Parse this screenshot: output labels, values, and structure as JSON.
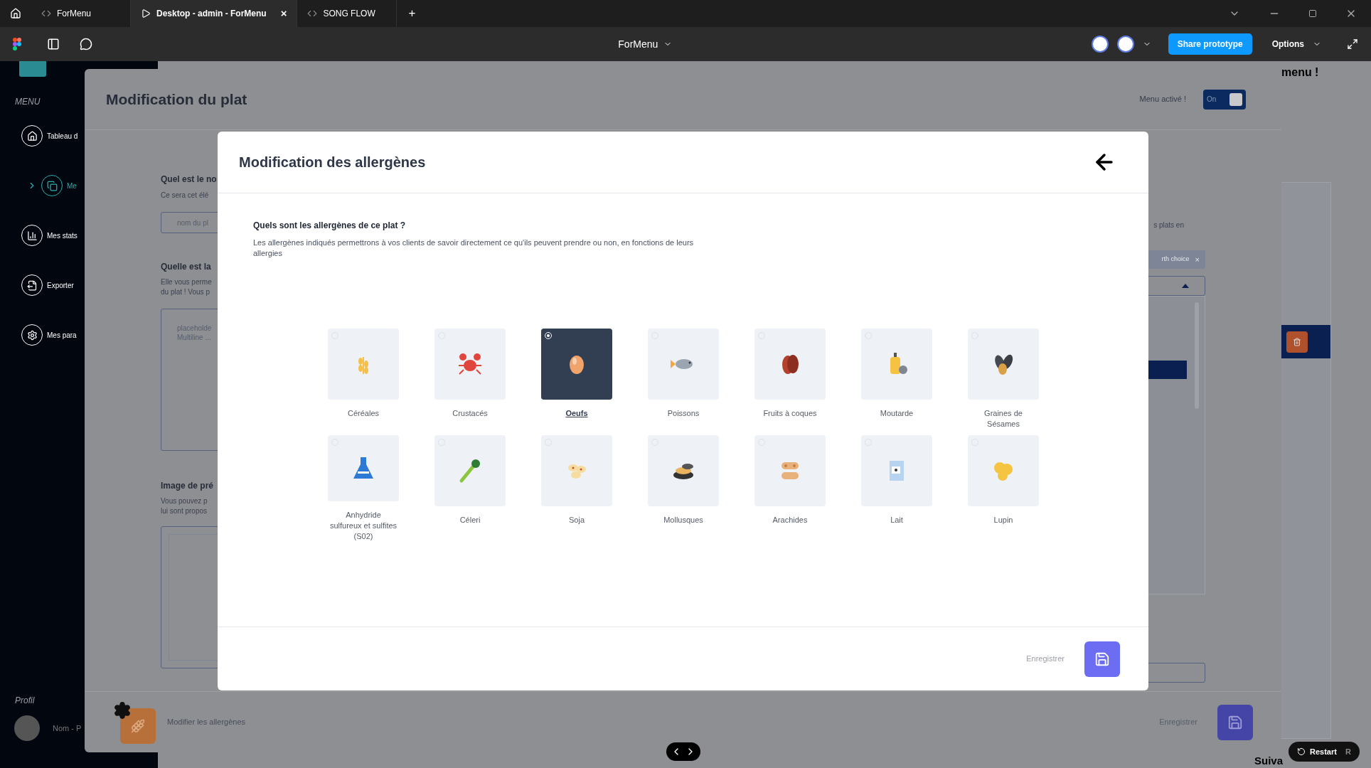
{
  "browser_tabs": [
    {
      "label": "ForMenu",
      "selected": false
    },
    {
      "label": "Desktop - admin - ForMenu",
      "selected": true,
      "close": "×"
    },
    {
      "label": "SONG FLOW",
      "selected": false
    }
  ],
  "new_tab": "+",
  "toolbar": {
    "file_name": "ForMenu",
    "share_button": "Share prototype",
    "options": "Options"
  },
  "sidebar": {
    "section": "MENU",
    "items": [
      {
        "label": "Tableau d",
        "selected": false
      },
      {
        "label": "Me",
        "selected": true
      },
      {
        "label": "Mes stats",
        "selected": false
      },
      {
        "label": "Exporter",
        "selected": false
      },
      {
        "label": "Mes para",
        "selected": false
      }
    ],
    "profile_heading": "Profil",
    "profile_name": "Nom - P"
  },
  "background_page": {
    "heading_tail": "menu !",
    "next_link": "Suiva"
  },
  "dish_panel": {
    "title": "Modification du plat",
    "menu_active_label": "Menu activé !",
    "toggle": {
      "label": "On",
      "on": true
    },
    "name_question": "Quel est le no",
    "name_hint": "Ce sera cet élé",
    "name_placeholder": "nom du pl",
    "description_question": "Quelle est la",
    "description_hint_lines": [
      "Elle vous perme",
      "du plat ! Vous p"
    ],
    "description_placeholder_lines": [
      "placeholde",
      "Multiline ..."
    ],
    "image_question": "Image de pré",
    "image_hint_lines": [
      "Vous pouvez p",
      "lui sont propos"
    ],
    "right_hint": "s plats en",
    "chip": {
      "label": "rth choice",
      "remove": "×"
    },
    "footer_label": "Modifier les allergènes",
    "footer_save": "Enregistrer"
  },
  "allergen_modal": {
    "title": "Modification des allergènes",
    "question": "Quels sont les allergènes de ce plat ?",
    "description": "Les allergènes indiqués permettrons à vos clients de savoir directement ce qu'ils peuvent prendre ou non, en fonctions de leurs allergies",
    "allergens": [
      {
        "label": "Céréales",
        "selected": false
      },
      {
        "label": "Crustacés",
        "selected": false
      },
      {
        "label": "Oeufs",
        "selected": true
      },
      {
        "label": "Poissons",
        "selected": false
      },
      {
        "label": "Fruits à coques",
        "selected": false
      },
      {
        "label": "Moutarde",
        "selected": false
      },
      {
        "label": "Graines de Sésames",
        "selected": false
      },
      {
        "label": "Anhydride sulfureux et sulfites (S02)",
        "selected": false
      },
      {
        "label": "Céleri",
        "selected": false
      },
      {
        "label": "Soja",
        "selected": false
      },
      {
        "label": "Mollusques",
        "selected": false
      },
      {
        "label": "Arachides",
        "selected": false
      },
      {
        "label": "Lait",
        "selected": false
      },
      {
        "label": "Lupin",
        "selected": false
      }
    ],
    "save_label": "Enregistrer"
  },
  "restart": {
    "label": "Restart",
    "shortcut": "R"
  }
}
